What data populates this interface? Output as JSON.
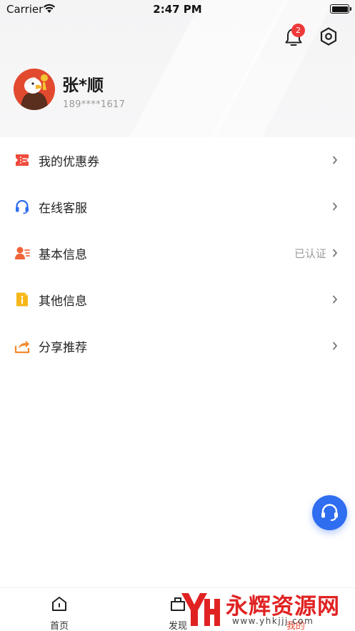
{
  "status_bar": {
    "carrier": "Carrier",
    "time": "2:47 PM"
  },
  "header": {
    "notification_count": "2"
  },
  "profile": {
    "name": "张*顺",
    "phone": "189****1617"
  },
  "menu": [
    {
      "label": "我的优惠券",
      "icon": "coupon-icon",
      "status": "",
      "color": "#ef4b3c"
    },
    {
      "label": "在线客服",
      "icon": "headset-icon",
      "status": "",
      "color": "#2f6ef0"
    },
    {
      "label": "基本信息",
      "icon": "user-card-icon",
      "status": "已认证",
      "color": "#f0643a"
    },
    {
      "label": "其他信息",
      "icon": "info-doc-icon",
      "status": "",
      "color": "#f5b818"
    },
    {
      "label": "分享推荐",
      "icon": "share-icon",
      "status": "",
      "color": "#f28a2c"
    }
  ],
  "tabbar": [
    {
      "label": "首页",
      "icon": "home-icon"
    },
    {
      "label": "发现",
      "icon": "discover-icon"
    },
    {
      "label": "我的",
      "icon": "mine-icon",
      "active": true
    }
  ],
  "watermark": {
    "title": "永辉资源网",
    "url": "www.yhkjjj.com"
  },
  "colors": {
    "accent": "#e94a35",
    "fab": "#2f6ef0",
    "badge": "#ef3a3a"
  }
}
